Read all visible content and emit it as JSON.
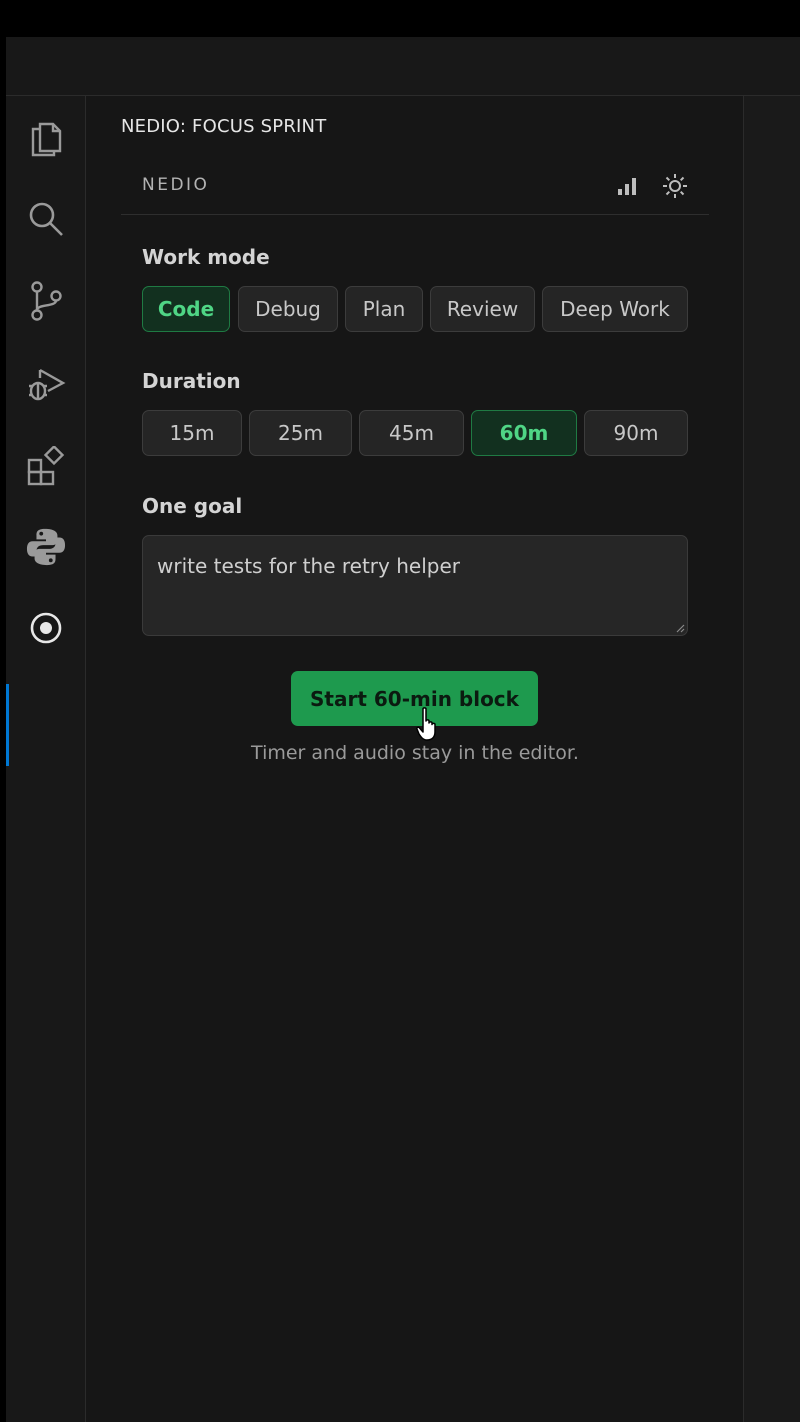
{
  "panel": {
    "title": "NEDIO: FOCUS SPRINT",
    "brand": "NEDIO"
  },
  "header_icons": [
    "stats-icon",
    "theme-sun-icon"
  ],
  "activity_bar": [
    "explorer-icon",
    "search-icon",
    "source-control-icon",
    "run-debug-icon",
    "extensions-icon",
    "python-icon",
    "focus-target-icon"
  ],
  "work_mode": {
    "label": "Work mode",
    "options": [
      "Code",
      "Debug",
      "Plan",
      "Review",
      "Deep Work"
    ],
    "selected": "Code"
  },
  "duration": {
    "label": "Duration",
    "options": [
      "15m",
      "25m",
      "45m",
      "60m",
      "90m"
    ],
    "selected": "60m"
  },
  "goal": {
    "label": "One goal",
    "value": "write tests for the retry helper"
  },
  "start_button": {
    "label": "Start 60-min block"
  },
  "hint": "Timer and audio stay in the editor.",
  "colors": {
    "accent_green": "#1e9a4e",
    "selected_text": "#4fd585",
    "active_indicator": "#0078d4"
  }
}
